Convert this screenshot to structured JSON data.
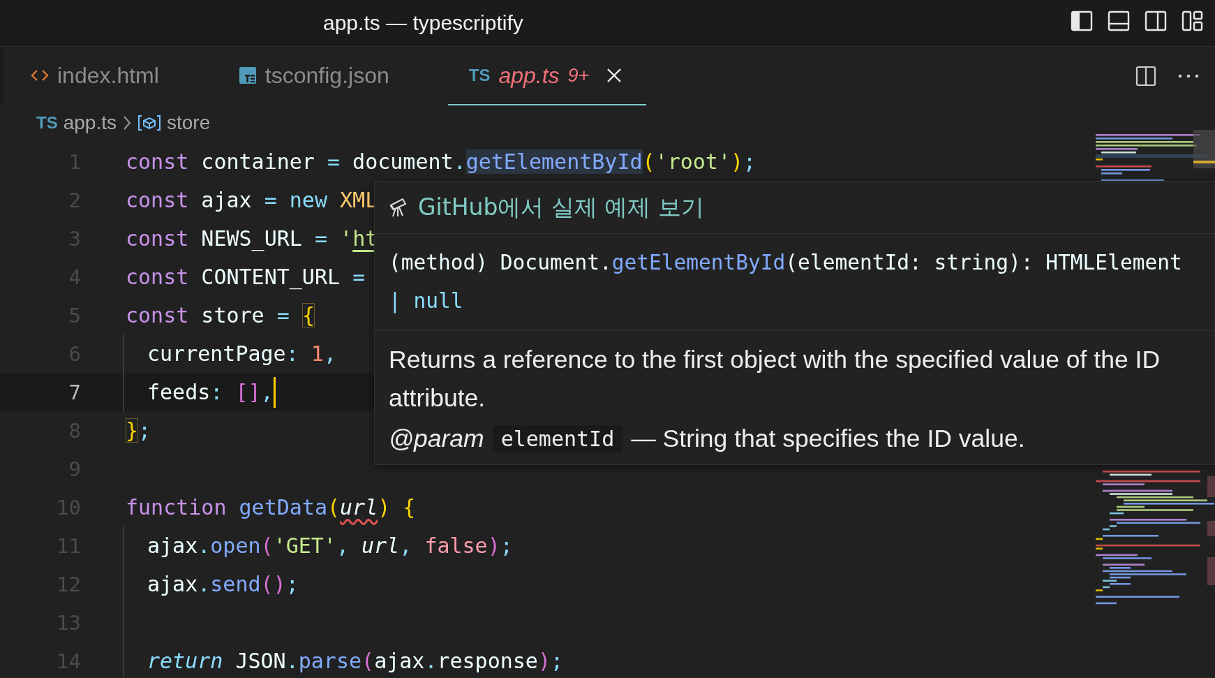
{
  "window": {
    "title": "app.ts — typescriptify"
  },
  "tabs": [
    {
      "label": "index.html",
      "kind": "html",
      "selected": false,
      "preview": false
    },
    {
      "label": "tsconfig.json",
      "kind": "tsjson",
      "selected": false,
      "preview": false
    },
    {
      "label": "app.ts",
      "kind": "ts",
      "icon_text": "TS",
      "selected": true,
      "preview": true,
      "problems": "9+"
    }
  ],
  "breadcrumbs": {
    "file_icon_text": "TS",
    "file": "app.ts",
    "symbol": "store"
  },
  "lines": [
    {
      "number": "1",
      "current": false,
      "indented": false,
      "tokens": [
        {
          "text": "const",
          "kind": "keyword"
        },
        {
          "text": " container ",
          "kind": "var"
        },
        {
          "text": "=",
          "kind": "op"
        },
        {
          "text": " document",
          "kind": "var"
        },
        {
          "text": ".",
          "kind": "op"
        },
        {
          "text": "getElementById",
          "kind": "fn",
          "highlight": true
        },
        {
          "text": "(",
          "kind": "bracket1"
        },
        {
          "text": "'root'",
          "kind": "string"
        },
        {
          "text": ")",
          "kind": "bracket1"
        },
        {
          "text": ";",
          "kind": "op"
        }
      ]
    },
    {
      "number": "2",
      "current": false,
      "indented": false,
      "tokens": [
        {
          "text": "const",
          "kind": "keyword"
        },
        {
          "text": " ajax ",
          "kind": "var"
        },
        {
          "text": "= new",
          "kind": "op"
        },
        {
          "text": " XML",
          "kind": "class"
        }
      ]
    },
    {
      "number": "3",
      "current": false,
      "indented": false,
      "tokens": [
        {
          "text": "const",
          "kind": "keyword"
        },
        {
          "text": " NEWS_URL ",
          "kind": "var"
        },
        {
          "text": "= ",
          "kind": "op"
        },
        {
          "text": "'",
          "kind": "string"
        },
        {
          "text": "ht",
          "kind": "link"
        }
      ]
    },
    {
      "number": "4",
      "current": false,
      "indented": false,
      "tokens": [
        {
          "text": "const",
          "kind": "keyword"
        },
        {
          "text": " CONTENT_URL ",
          "kind": "var"
        },
        {
          "text": "=",
          "kind": "op"
        }
      ]
    },
    {
      "number": "5",
      "current": false,
      "indented": false,
      "tokens": [
        {
          "text": "const",
          "kind": "keyword"
        },
        {
          "text": " store ",
          "kind": "var"
        },
        {
          "text": "= ",
          "kind": "op"
        },
        {
          "text": "{",
          "kind": "bracket1",
          "matched": true
        }
      ]
    },
    {
      "number": "6",
      "current": false,
      "indented": true,
      "tokens": [
        {
          "text": "currentPage",
          "kind": "var"
        },
        {
          "text": ": ",
          "kind": "op"
        },
        {
          "text": "1",
          "kind": "number"
        },
        {
          "text": ",",
          "kind": "op"
        }
      ]
    },
    {
      "number": "7",
      "current": true,
      "indented": true,
      "tokens": [
        {
          "text": "feeds",
          "kind": "var"
        },
        {
          "text": ": ",
          "kind": "op"
        },
        {
          "text": "[]",
          "kind": "bracket2"
        },
        {
          "text": ",",
          "kind": "op"
        }
      ]
    },
    {
      "number": "8",
      "current": false,
      "indented": false,
      "tokens": [
        {
          "text": "}",
          "kind": "bracket1",
          "matched": true
        },
        {
          "text": ";",
          "kind": "op"
        }
      ]
    },
    {
      "number": "9",
      "current": false,
      "indented": false
    },
    {
      "number": "10",
      "current": false,
      "indented": false,
      "tokens": [
        {
          "text": "function",
          "kind": "keyword"
        },
        {
          "text": " getData",
          "kind": "fn"
        },
        {
          "text": "(",
          "kind": "bracket1"
        },
        {
          "text": "url",
          "kind": "param",
          "error": true
        },
        {
          "text": ") {",
          "kind": "bracket1"
        }
      ]
    },
    {
      "number": "11",
      "current": false,
      "indented": true,
      "tokens": [
        {
          "text": "ajax",
          "kind": "var"
        },
        {
          "text": ".",
          "kind": "op"
        },
        {
          "text": "open",
          "kind": "fn"
        },
        {
          "text": "(",
          "kind": "bracket2"
        },
        {
          "text": "'GET'",
          "kind": "string"
        },
        {
          "text": ", ",
          "kind": "op"
        },
        {
          "text": "url",
          "kind": "param"
        },
        {
          "text": ", ",
          "kind": "op"
        },
        {
          "text": "false",
          "kind": "bool"
        },
        {
          "text": ")",
          "kind": "bracket2"
        },
        {
          "text": ";",
          "kind": "op"
        }
      ]
    },
    {
      "number": "12",
      "current": false,
      "indented": true,
      "tokens": [
        {
          "text": "ajax",
          "kind": "var"
        },
        {
          "text": ".",
          "kind": "op"
        },
        {
          "text": "send",
          "kind": "fn"
        },
        {
          "text": "()",
          "kind": "bracket2"
        },
        {
          "text": ";",
          "kind": "op"
        }
      ]
    },
    {
      "number": "13",
      "current": false,
      "indented": true
    },
    {
      "number": "14",
      "current": false,
      "indented": true,
      "tokens": [
        {
          "text": "return",
          "kind": "keyword-italic"
        },
        {
          "text": " JSON",
          "kind": "var"
        },
        {
          "text": ".",
          "kind": "op"
        },
        {
          "text": "parse",
          "kind": "fn"
        },
        {
          "text": "(",
          "kind": "bracket2"
        },
        {
          "text": "ajax",
          "kind": "var"
        },
        {
          "text": ".",
          "kind": "op"
        },
        {
          "text": "response",
          "kind": "var"
        },
        {
          "text": ")",
          "kind": "bracket2"
        },
        {
          "text": ";",
          "kind": "op"
        }
      ]
    }
  ],
  "hover": {
    "link": "GitHub에서 실제 예제 보기",
    "signature_lines": [
      [
        {
          "text": "(method) Document.",
          "kind": "var"
        },
        {
          "text": "getElementById",
          "kind": "fn"
        },
        {
          "text": "(elementId: string): HTMLElement",
          "kind": "var"
        }
      ],
      [
        {
          "text": "| null",
          "kind": "op"
        }
      ]
    ],
    "description": "Returns a reference to the first object with the specified value of the ID attribute.",
    "param_tag": "@param",
    "param_name": "elementId",
    "param_text": "— String that specifies the ID value."
  }
}
